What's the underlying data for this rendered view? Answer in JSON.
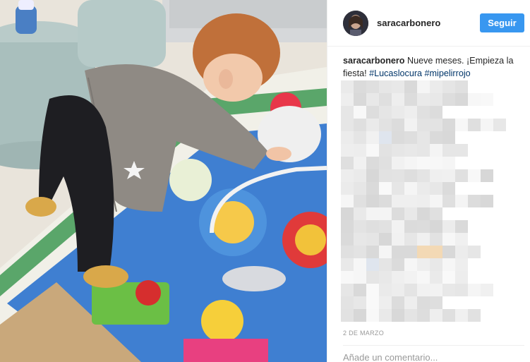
{
  "header": {
    "username": "saracarbonero",
    "follow_label": "Seguir"
  },
  "caption": {
    "username": "saracarbonero",
    "text": " Nueve meses. ¡Empieza la fiesta! ",
    "hashtags": [
      "#Lucaslocura",
      "#mipelirrojo"
    ]
  },
  "post": {
    "date": "2 DE MARZO",
    "comment_placeholder": "Añade un comentario..."
  },
  "colors": {
    "follow_button": "#3897f0",
    "hashtag": "#003569",
    "date": "#999999"
  }
}
